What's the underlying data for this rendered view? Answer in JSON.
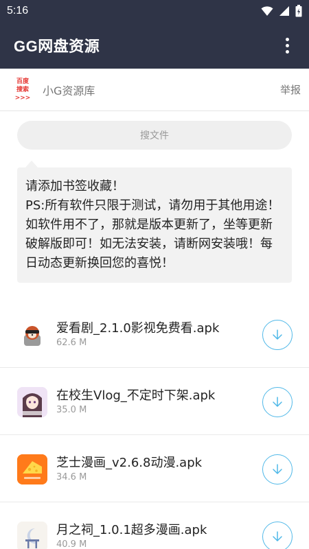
{
  "status_bar": {
    "time": "5:16"
  },
  "app_bar": {
    "title": "GG网盘资源"
  },
  "ad": {
    "logo_line1": "百度",
    "logo_line2": "搜索>>>",
    "text": "小G资源库",
    "report": "举报"
  },
  "search": {
    "placeholder": "搜文件"
  },
  "notice": {
    "line1": "请添加书签收藏！",
    "line2": "PS:所有软件只限于测试，请勿用于其他用途！如软件用不了，那就是版本更新了，坐等更新破解版即可！如无法安装，请断网安装哦！每日动态更新换回您的喜悦！"
  },
  "files": [
    {
      "name": "爱看剧_2.1.0影视免费看.apk",
      "size": "62.6 M",
      "icon": "red-panda-app-icon"
    },
    {
      "name": "在校生Vlog_不定时下架.apk",
      "size": "35.0 M",
      "icon": "anime-girl-app-icon"
    },
    {
      "name": "芝士漫画_v2.6.8动漫.apk",
      "size": "34.6 M",
      "icon": "cheese-app-icon"
    },
    {
      "name": "月之祠_1.0.1超多漫画.apk",
      "size": "40.9 M",
      "icon": "moon-shrine-app-icon"
    }
  ],
  "colors": {
    "header": "#2f3447",
    "accent": "#4fb8e8",
    "ad_logo": "#e53935",
    "cheese_icon": "#ff7a1a"
  }
}
